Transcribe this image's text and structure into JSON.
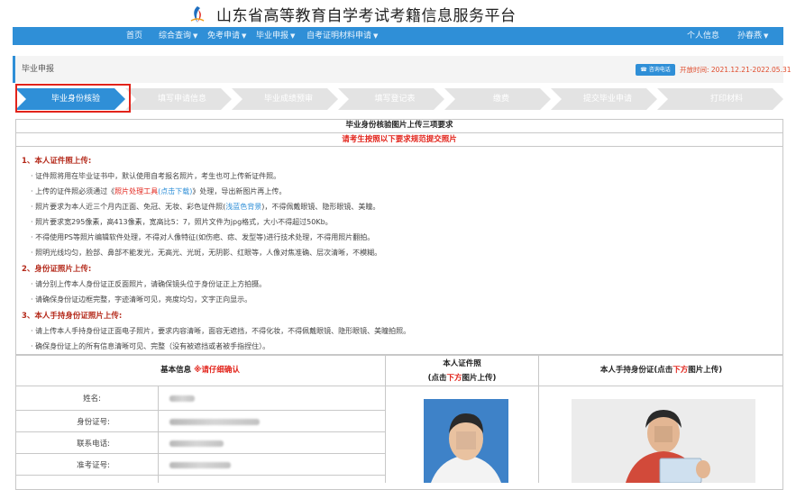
{
  "header": {
    "title": "山东省高等教育自学考试考籍信息服务平台",
    "logo_icon": "platform-logo-icon"
  },
  "nav": {
    "items": [
      {
        "label": "首页",
        "caret": ""
      },
      {
        "label": "综合查询",
        "caret": "▼"
      },
      {
        "label": "免考申请",
        "caret": "▼"
      },
      {
        "label": "毕业申报",
        "caret": "▼"
      },
      {
        "label": "自考证明材料申请",
        "caret": "▼"
      }
    ],
    "personal_info": "个人信息",
    "user_name": "孙春燕",
    "user_caret": "▼"
  },
  "breadcrumb": "毕业申报",
  "hotline_label": "咨询电话",
  "period": "开放时间: 2021.12.21-2022.05.31",
  "steps": [
    "毕业身份核验",
    "填写申请信息",
    "毕业成绩预审",
    "填写登记表",
    "缴费",
    "提交毕业申请",
    "打印材料"
  ],
  "requirements": {
    "title": "毕业身份核验图片上传三项要求",
    "subtitle": "请考生按照以下要求规范提交照片",
    "sections": [
      {
        "title": "1、本人证件照上传:",
        "lines": [
          {
            "a": "· 证件照将用在毕业证书中，默认使用自考报名照片，考生也可上传新证件照。"
          },
          {
            "a": "· 上传的证件照必须通过《",
            "b": "照片处理工具",
            "c": "(点击下载)",
            "d": "》处理，导出新图片再上传。"
          },
          {
            "a": "· 照片要求为本人近三个月内正面、免冠、无妆、彩色证件照(",
            "c": "浅蓝色背景",
            "d": ")，不得佩戴眼镜、隐形眼镜、美瞳。"
          },
          {
            "a": "· 照片要求宽295像素，高413像素，宽高比5：7，照片文件为jpg格式，大小不得超过50Kb。"
          },
          {
            "a": "· 不得使用PS等照片编辑软件处理，不得对人像特征(如伤疤、痣、发型等)进行技术处理，不得用照片翻拍。"
          },
          {
            "a": "· 照明光线均匀，脸部、鼻部不能发光，无高光、光斑，无阴影、红眼等，人像对焦准确、层次清晰，不模糊。"
          }
        ]
      },
      {
        "title": "2、身份证照片上传:",
        "lines": [
          {
            "a": "· 请分别上传本人身份证正反面照片，请确保镜头位于身份证正上方拍摄。"
          },
          {
            "a": "· 请确保身份证边框完整，字迹清晰可见，亮度均匀，文字正向显示。"
          }
        ]
      },
      {
        "title": "3、本人手持身份证照片上传:",
        "lines": [
          {
            "a": "· 请上传本人手持身份证正面电子照片，要求内容清晰，面容无遮挡，不得化妆，不得佩戴眼镜、隐形眼镜、美瞳拍照。"
          },
          {
            "a": "· 确保身份证上的所有信息清晰可见、完整（没有被遮挡或者被手指捏住）。"
          }
        ]
      }
    ]
  },
  "info_table": {
    "basic_head": "基本信息",
    "basic_note": "※请仔细确认",
    "photo_head_1": "本人证件照",
    "photo_head_2a": "(点击",
    "photo_head_2b": "下方",
    "photo_head_2c": "图片上传)",
    "hold_head_a": "本人手持身份证(点击",
    "hold_head_b": "下方",
    "hold_head_c": "图片上传)",
    "fields": [
      {
        "label": "姓名:"
      },
      {
        "label": "身份证号:"
      },
      {
        "label": "联系电话:"
      },
      {
        "label": "准考证号:"
      }
    ]
  },
  "colors": {
    "accent": "#2f8fd7",
    "red": "#e2231a",
    "step_active": "#2f8fd7",
    "step_inactive": "#e3e3e3"
  }
}
